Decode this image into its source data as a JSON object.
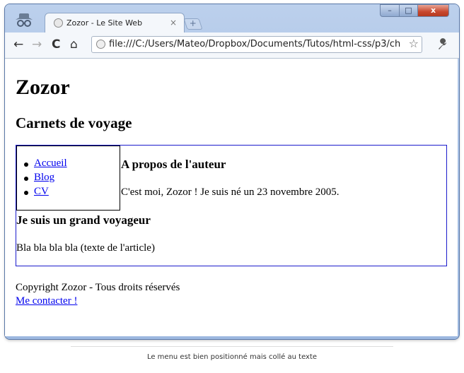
{
  "browser": {
    "tab_title": "Zozor - Le Site Web",
    "tab_close": "×",
    "new_tab": "+",
    "url": "file:///C:/Users/Mateo/Dropbox/Documents/Tutos/html-css/p3/ch",
    "window_controls": {
      "minimize": "–",
      "maximize": "□",
      "close": "x"
    },
    "nav": {
      "back": "←",
      "forward": "→",
      "reload": "C",
      "home": "⌂"
    },
    "star": "☆",
    "wrench": "🔧"
  },
  "page": {
    "site_title": "Zozor",
    "slogan": "Carnets de voyage",
    "menu": [
      {
        "label": "Accueil"
      },
      {
        "label": "Blog"
      },
      {
        "label": "CV"
      }
    ],
    "aside": {
      "title": "A propos de l'auteur",
      "text": "C'est moi, Zozor ! Je suis né un 23 novembre 2005."
    },
    "article": {
      "title": "Je suis un grand voyageur",
      "text": "Bla bla bla bla (texte de l'article)"
    },
    "footer": {
      "copyright": "Copyright Zozor - Tous droits réservés",
      "contact_link": "Me contacter !"
    }
  },
  "caption": "Le menu est bien positionné mais collé au texte",
  "colors": {
    "section_border": "#1b1bcc",
    "link": "#0000ee",
    "close_button": "#c7472e"
  }
}
